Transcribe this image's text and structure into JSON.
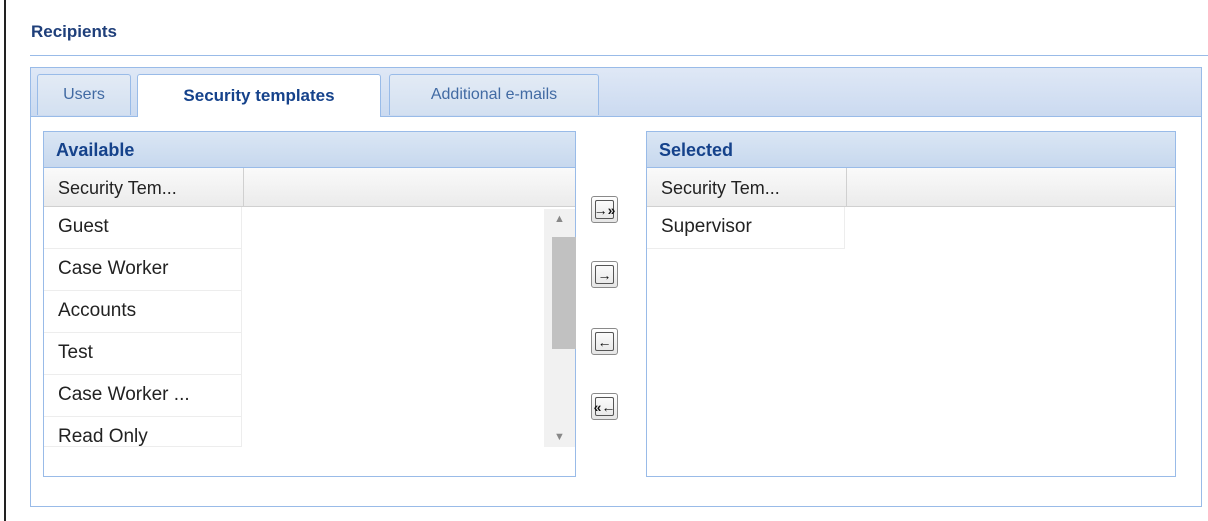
{
  "section": {
    "title": "Recipients"
  },
  "tabs": [
    {
      "label": "Users"
    },
    {
      "label": "Security templates"
    },
    {
      "label": "Additional e-mails"
    }
  ],
  "available": {
    "title": "Available",
    "column_header": "Security Tem...",
    "items": [
      "Guest",
      "Case Worker",
      "Accounts",
      "Test",
      "Case Worker ...",
      "Read Only"
    ]
  },
  "selected": {
    "title": "Selected",
    "column_header": "Security Tem...",
    "items": [
      "Supervisor"
    ]
  },
  "move_buttons": {
    "add_all": "→»",
    "add": "→",
    "remove": "←",
    "remove_all": "«←"
  },
  "colors": {
    "accent": "#15428b",
    "border": "#99bbe8"
  }
}
